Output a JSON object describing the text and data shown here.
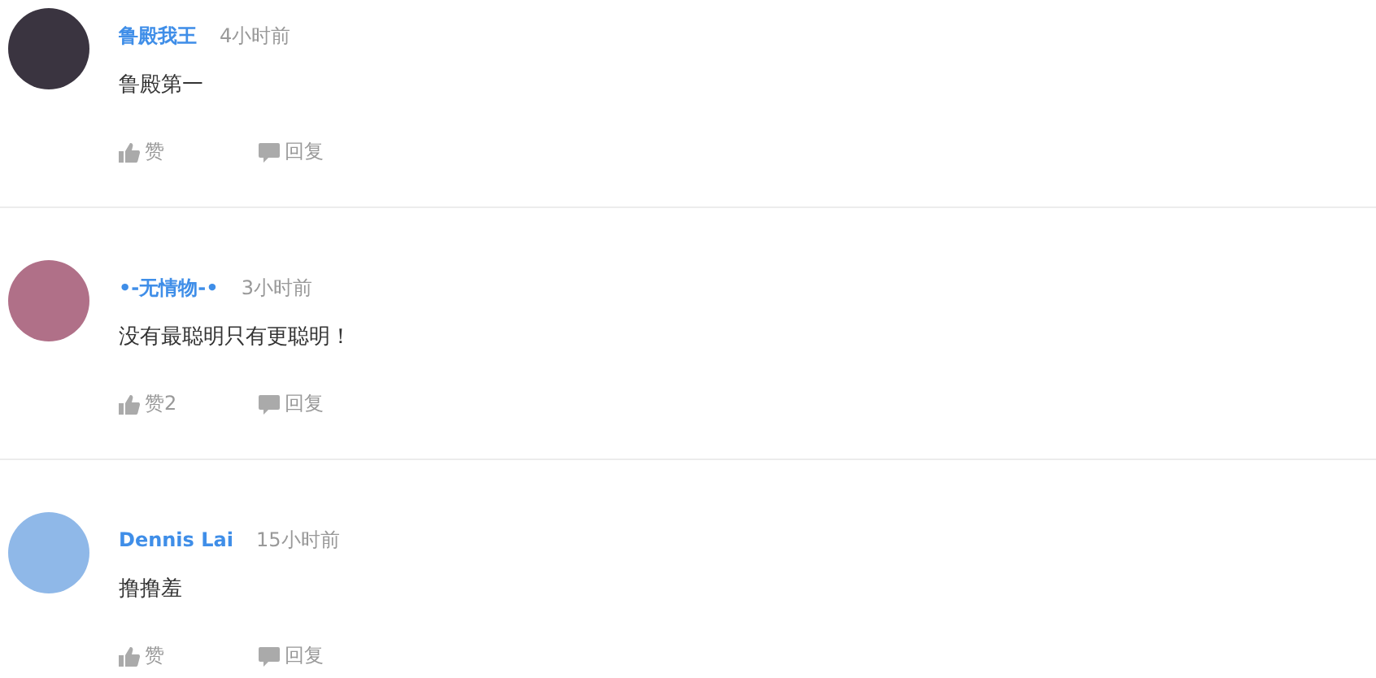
{
  "comments": [
    {
      "author": "鲁殿我王",
      "time": "4小时前",
      "text": "鲁殿第一",
      "like": "赞",
      "reply": "回复",
      "color": "#3a3440"
    },
    {
      "author": "•-无情物-•",
      "time": "3小时前",
      "text": "没有最聪明只有更聪明！",
      "like": "赞2",
      "reply": "回复",
      "color": "#b07088"
    },
    {
      "author": "Dennis Lai",
      "time": "15小时前",
      "text": "撸撸羞",
      "like": "赞",
      "reply": "回复",
      "color": "#8fb8e8"
    }
  ]
}
